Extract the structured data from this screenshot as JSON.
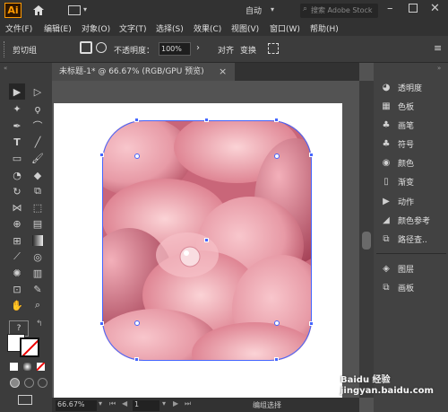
{
  "app": {
    "logo": "Ai",
    "workspace": "自动",
    "search_placeholder": "搜索 Adobe Stock"
  },
  "menu": [
    "文件(F)",
    "编辑(E)",
    "对象(O)",
    "文字(T)",
    "选择(S)",
    "效果(C)",
    "视图(V)",
    "窗口(W)",
    "帮助(H)"
  ],
  "control": {
    "group_label": "剪切组",
    "opacity_label": "不透明度：",
    "opacity_value": "100%",
    "align_label": "对齐",
    "transform_label": "变换"
  },
  "document": {
    "tab_title": "未标题-1* @ 66.67% (RGB/GPU 预览)",
    "close": "×"
  },
  "status": {
    "zoom": "66.67%",
    "page": "1",
    "mode": "编组选择"
  },
  "panels": [
    "透明度",
    "色板",
    "画笔",
    "符号",
    "颜色",
    "渐变",
    "动作",
    "颜色参考",
    "路径查..",
    "图层",
    "画板"
  ],
  "colors": {
    "accent": "#ff9a00",
    "selection": "#4466ff"
  },
  "watermark": "Baidu 经验 jingyan.baidu.com"
}
